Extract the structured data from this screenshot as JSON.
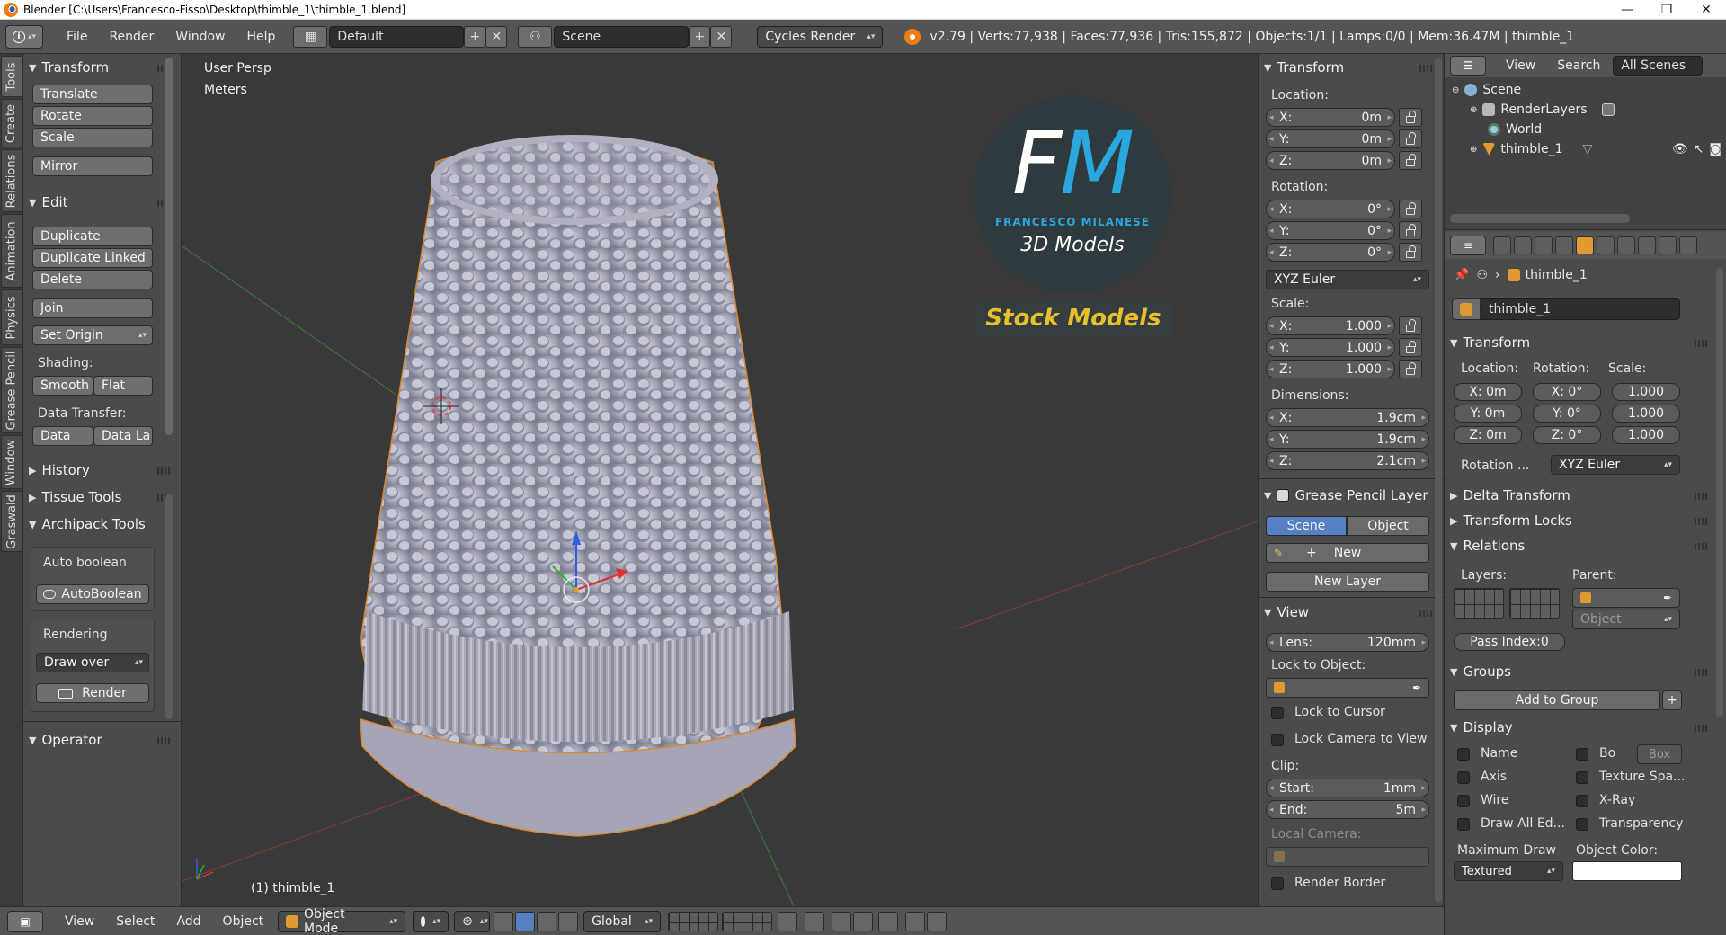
{
  "window": {
    "title": "Blender [C:\\Users\\Francesco-Fisso\\Desktop\\thimble_1\\thimble_1.blend]",
    "controls": [
      "—",
      "❐",
      "✕"
    ]
  },
  "info_header": {
    "editor_icon": "i",
    "menus": [
      "File",
      "Render",
      "Window",
      "Help"
    ],
    "screen_layout": "Default",
    "scene": "Scene",
    "render_engine": "Cycles Render",
    "stats": "v2.79 | Verts:77,938 | Faces:77,936 | Tris:155,872 | Objects:1/1 | Lamps:0/0 | Mem:36.47M | thimble_1"
  },
  "tool_tabs": [
    "Tools",
    "Create",
    "Relations",
    "Animation",
    "Physics",
    "Grease Pencil",
    "Window",
    "Graswald"
  ],
  "tool_shelf": {
    "transform_header": "Transform",
    "translate": "Translate",
    "rotate": "Rotate",
    "scale": "Scale",
    "mirror": "Mirror",
    "edit_header": "Edit",
    "duplicate": "Duplicate",
    "duplicate_linked": "Duplicate Linked",
    "delete": "Delete",
    "join": "Join",
    "set_origin": "Set Origin",
    "shading_label": "Shading:",
    "smooth": "Smooth",
    "flat": "Flat",
    "data_transfer_label": "Data Transfer:",
    "data": "Data",
    "data_la": "Data La",
    "history_header": "History",
    "tissue_header": "Tissue Tools",
    "archipack_header": "Archipack Tools",
    "auto_boolean_label": "Auto boolean",
    "auto_boolean_btn": "AutoBoolean",
    "rendering_label": "Rendering",
    "draw_over": "Draw over",
    "render": "Render",
    "operator_header": "Operator"
  },
  "viewport": {
    "view_name": "User Persp",
    "units": "Meters",
    "object_label": "(1) thimble_1",
    "logo_letters": "FM",
    "logo_name": "FRANCESCO MILANESE",
    "logo_sub": "3D Models",
    "logo_tag": "Stock Models"
  },
  "n_panel": {
    "transform_header": "Transform",
    "location_label": "Location:",
    "location": [
      {
        "axis": "X:",
        "value": "0m"
      },
      {
        "axis": "Y:",
        "value": "0m"
      },
      {
        "axis": "Z:",
        "value": "0m"
      }
    ],
    "rotation_label": "Rotation:",
    "rotation": [
      {
        "axis": "X:",
        "value": "0°"
      },
      {
        "axis": "Y:",
        "value": "0°"
      },
      {
        "axis": "Z:",
        "value": "0°"
      }
    ],
    "rotation_mode": "XYZ Euler",
    "scale_label": "Scale:",
    "scale": [
      {
        "axis": "X:",
        "value": "1.000"
      },
      {
        "axis": "Y:",
        "value": "1.000"
      },
      {
        "axis": "Z:",
        "value": "1.000"
      }
    ],
    "dimensions_label": "Dimensions:",
    "dimensions": [
      {
        "axis": "X:",
        "value": "1.9cm"
      },
      {
        "axis": "Y:",
        "value": "1.9cm"
      },
      {
        "axis": "Z:",
        "value": "2.1cm"
      }
    ],
    "grease_header": "Grease Pencil Layer",
    "scene_btn": "Scene",
    "object_btn": "Object",
    "new_btn": "New",
    "new_layer_btn": "New Layer",
    "view_header": "View",
    "lens_label": "Lens:",
    "lens_value": "120mm",
    "lock_to_object_label": "Lock to Object:",
    "lock_to_cursor": "Lock to Cursor",
    "lock_camera": "Lock Camera to View",
    "clip_label": "Clip:",
    "clip_start_label": "Start:",
    "clip_start": "1mm",
    "clip_end_label": "End:",
    "clip_end": "5m",
    "local_camera_label": "Local Camera:",
    "render_border": "Render Border"
  },
  "outliner": {
    "menus": [
      "View",
      "Search"
    ],
    "filter": "All Scenes",
    "items": [
      {
        "name": "Scene",
        "indent": 0
      },
      {
        "name": "RenderLayers",
        "indent": 1
      },
      {
        "name": "World",
        "indent": 1
      },
      {
        "name": "thimble_1",
        "indent": 1
      }
    ]
  },
  "properties": {
    "breadcrumb": "thimble_1",
    "object_name": "thimble_1",
    "transform_header": "Transform",
    "location_label": "Location:",
    "rotation_label": "Rotation:",
    "scale_label": "Scale:",
    "loc_values": [
      "X: 0m",
      "Y: 0m",
      "Z: 0m"
    ],
    "rot_values": [
      "X:  0°",
      "Y:  0°",
      "Z:  0°"
    ],
    "scale_values": [
      "1.000",
      "1.000",
      "1.000"
    ],
    "rotation_mode_label": "Rotation ...",
    "rotation_mode": "XYZ Euler",
    "delta_header": "Delta Transform",
    "locks_header": "Transform Locks",
    "relations_header": "Relations",
    "layers_label": "Layers:",
    "parent_label": "Parent:",
    "parent_type": "Object",
    "pass_index": "Pass Index:0",
    "groups_header": "Groups",
    "add_to_group": "Add to Group",
    "display_header": "Display",
    "display_left": [
      "Name",
      "Axis",
      "Wire",
      "Draw All Ed..."
    ],
    "display_right": [
      "Bo",
      "Texture Spa...",
      "X-Ray",
      "Transparency"
    ],
    "bounds_type": "Box",
    "max_draw_label": "Maximum Draw",
    "max_draw": "Textured",
    "object_color_label": "Object Color:"
  },
  "bottom_header": {
    "menus": [
      "View",
      "Select",
      "Add",
      "Object"
    ],
    "mode": "Object Mode",
    "orientation": "Global"
  },
  "colors": {
    "accent_blue": "#5680c2",
    "object_orange": "#e09a30",
    "logo_blue": "#2aa7dc",
    "logo_yellow": "#e6c02a"
  }
}
